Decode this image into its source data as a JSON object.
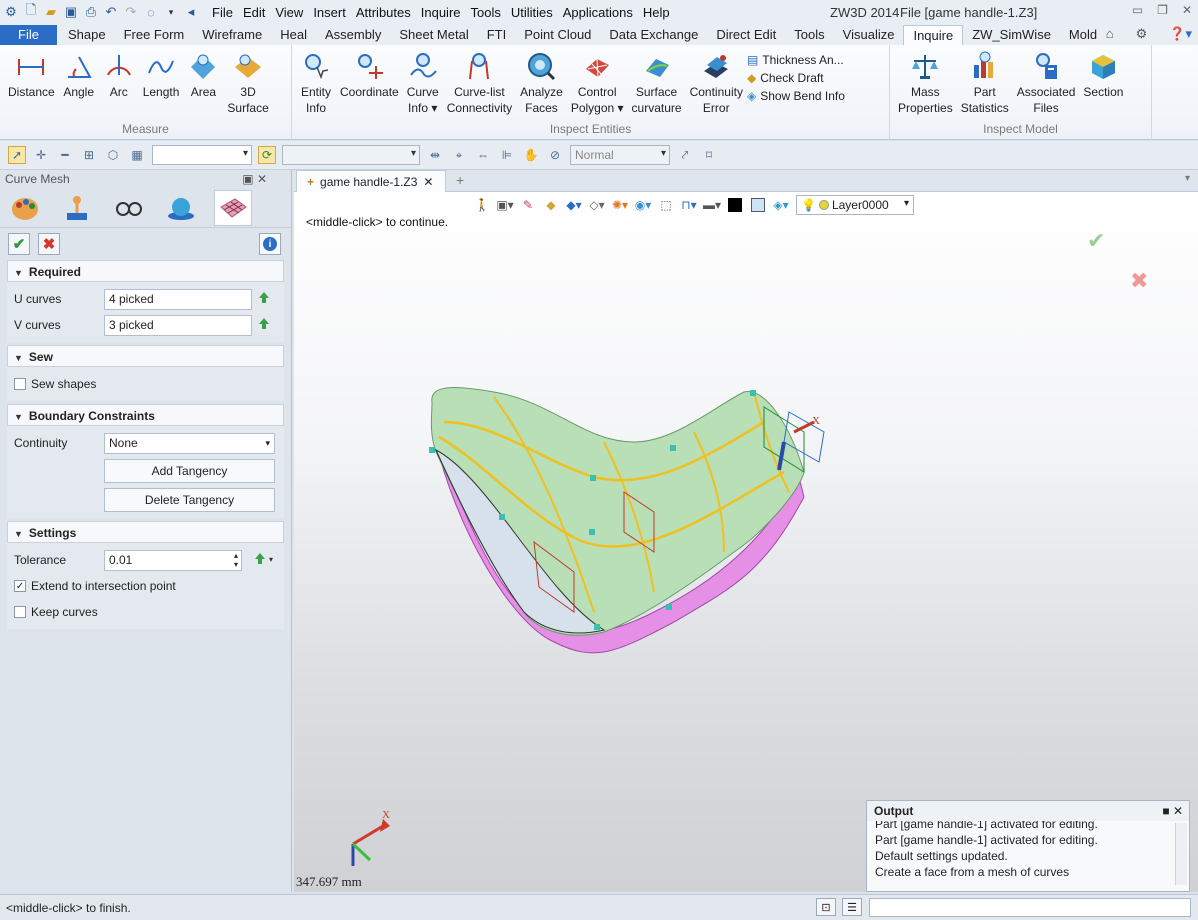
{
  "titlebar": {
    "menus": [
      "File",
      "Edit",
      "View",
      "Insert",
      "Attributes",
      "Inquire",
      "Tools",
      "Utilities",
      "Applications",
      "Help"
    ],
    "app_name": "ZW3D 2014",
    "file_title": "File [game handle-1.Z3]"
  },
  "ribbon_tabs": [
    "File",
    "Shape",
    "Free Form",
    "Wireframe",
    "Heal",
    "Assembly",
    "Sheet Metal",
    "FTI",
    "Point Cloud",
    "Data Exchange",
    "Direct Edit",
    "Tools",
    "Visualize",
    "Inquire",
    "ZW_SimWise",
    "Mold"
  ],
  "active_tab": "Inquire",
  "ribbon": {
    "measure": {
      "name": "Measure",
      "buttons": [
        {
          "line1": "Distance",
          "line2": "",
          "icon": "distance-icon"
        },
        {
          "line1": "Angle",
          "line2": "",
          "icon": "angle-icon"
        },
        {
          "line1": "Arc",
          "line2": "",
          "icon": "arc-icon"
        },
        {
          "line1": "Length",
          "line2": "",
          "icon": "length-icon"
        },
        {
          "line1": "Area",
          "line2": "",
          "icon": "area-icon"
        },
        {
          "line1": "3D",
          "line2": "Surface",
          "icon": "surface-3d-icon"
        }
      ]
    },
    "inspect_entities": {
      "name": "Inspect Entities",
      "buttons": [
        {
          "line1": "Entity",
          "line2": "Info",
          "icon": "entity-info-icon"
        },
        {
          "line1": "Coordinate",
          "line2": "",
          "icon": "coordinate-icon"
        },
        {
          "line1": "Curve",
          "line2": "Info ▾",
          "icon": "curve-info-icon"
        },
        {
          "line1": "Curve-list",
          "line2": "Connectivity",
          "icon": "curve-list-icon"
        },
        {
          "line1": "Analyze",
          "line2": "Faces",
          "icon": "analyze-faces-icon"
        },
        {
          "line1": "Control",
          "line2": "Polygon ▾",
          "icon": "control-polygon-icon"
        },
        {
          "line1": "Surface",
          "line2": "curvature",
          "icon": "surface-curvature-icon"
        },
        {
          "line1": "Continuity",
          "line2": "Error",
          "icon": "continuity-error-icon"
        }
      ],
      "small": [
        "Thickness An...",
        "Check Draft",
        "Show Bend Info"
      ]
    },
    "inspect_model": {
      "name": "Inspect Model",
      "buttons": [
        {
          "line1": "Mass",
          "line2": "Properties",
          "icon": "mass-properties-icon"
        },
        {
          "line1": "Part",
          "line2": "Statistics",
          "icon": "part-statistics-icon"
        },
        {
          "line1": "Associated",
          "line2": "Files",
          "icon": "associated-files-icon"
        },
        {
          "line1": "Section",
          "line2": "",
          "icon": "section-icon"
        }
      ]
    }
  },
  "toolbar2": {
    "style_value": "Normal"
  },
  "panel": {
    "title": "Curve Mesh",
    "required": {
      "header": "Required",
      "u_label": "U curves",
      "u_value": "4 picked",
      "v_label": "V curves",
      "v_value": "3 picked"
    },
    "sew": {
      "header": "Sew",
      "sew_shapes": "Sew shapes",
      "checked": false
    },
    "boundary": {
      "header": "Boundary Constraints",
      "continuity_label": "Continuity",
      "continuity_value": "None",
      "add_tangency": "Add Tangency",
      "delete_tangency": "Delete Tangency"
    },
    "settings": {
      "header": "Settings",
      "tolerance_label": "Tolerance",
      "tolerance_value": "0.01",
      "extend_label": "Extend to intersection point",
      "extend_checked": true,
      "keep_label": "Keep curves",
      "keep_checked": false
    }
  },
  "viewport": {
    "tab_label": "game handle-1.Z3",
    "layer": "Layer0000",
    "hint": "<middle-click> to continue.",
    "coord": "347.697 mm",
    "axis_label": "X",
    "part_axis_label": "X"
  },
  "output": {
    "title": "Output",
    "lines": [
      "Part [game handle-1] activated for editing.",
      "Part [game handle-1] activated for editing.",
      "Default settings updated.",
      "Create a face from a mesh of curves"
    ]
  },
  "status": {
    "text": "<middle-click> to finish."
  },
  "colors": {
    "file_tab": "#2b6cc4",
    "mesh_green": "#b8e0b0",
    "mesh_pink": "#e48ee0",
    "curve_yellow": "#f0c020"
  }
}
